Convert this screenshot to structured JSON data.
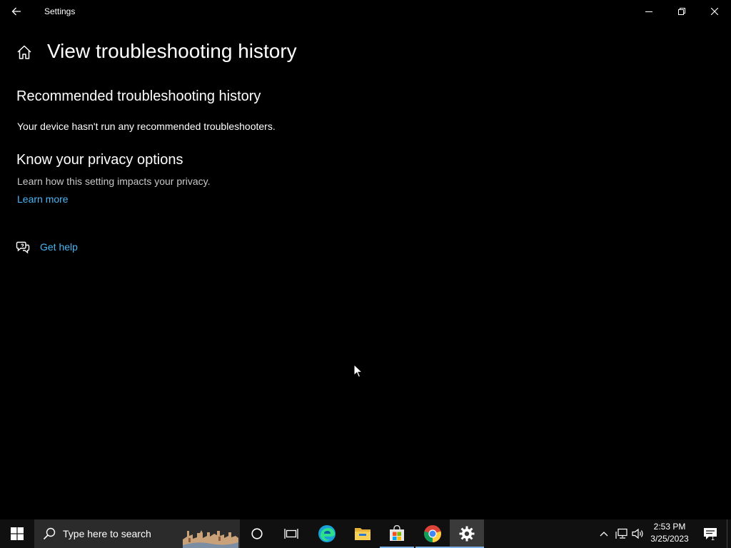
{
  "window": {
    "title": "Settings"
  },
  "page": {
    "title": "View troubleshooting history",
    "sections": [
      {
        "title": "Recommended troubleshooting history",
        "body": "Your device hasn't run any recommended troubleshooters."
      },
      {
        "title": "Know your privacy options",
        "body": "Learn how this setting impacts your privacy.",
        "link": "Learn more"
      }
    ],
    "help": {
      "label": "Get help"
    }
  },
  "taskbar": {
    "search_placeholder": "Type here to search",
    "apps": [
      "cortana-icon",
      "task-view-icon",
      "edge-icon",
      "file-explorer-icon",
      "store-icon",
      "chrome-icon",
      "settings-icon"
    ],
    "active_app": "settings-icon",
    "clock": {
      "time": "2:53 PM",
      "date": "3/25/2023"
    },
    "notifications_count": "1"
  },
  "colors": {
    "background": "#000000",
    "link": "#4cb5f5",
    "taskbar": "#101010"
  }
}
